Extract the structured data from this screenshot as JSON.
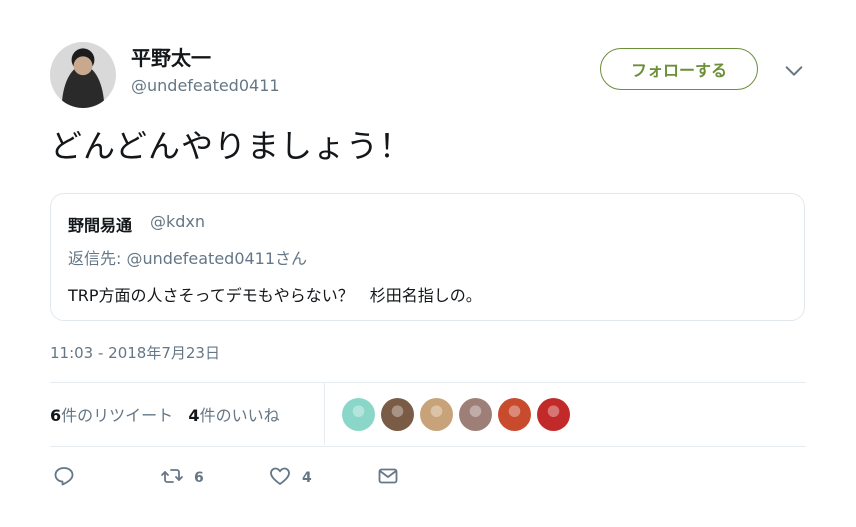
{
  "author": {
    "display_name": "平野太一",
    "handle": "@undefeated0411"
  },
  "follow_button_label": "フォローする",
  "tweet_text": "どんどんやりましょう！",
  "quoted_tweet": {
    "author_name": "野間易通",
    "author_handle": "@kdxn",
    "reply_to": "返信先: @undefeated0411さん",
    "text": "TRP方面の人さそってデモもやらない？　杉田名指しの。"
  },
  "timestamp": "11:03 - 2018年7月23日",
  "stats": {
    "retweet_count": "6",
    "retweet_label": "件のリツイート",
    "like_count": "4",
    "like_label": "件のいいね"
  },
  "liker_avatars": [
    {
      "name": "liker-1",
      "color": "#8ad7c9"
    },
    {
      "name": "liker-2",
      "color": "#7a5b45"
    },
    {
      "name": "liker-3",
      "color": "#c8a37a"
    },
    {
      "name": "liker-4",
      "color": "#9d7f78"
    },
    {
      "name": "liker-5",
      "color": "#c84b2e"
    },
    {
      "name": "liker-6",
      "color": "#c22a2a"
    }
  ],
  "actions": {
    "reply_count": "",
    "retweet_count": "6",
    "like_count": "4"
  },
  "colors": {
    "follow_accent": "#6c8f3a",
    "secondary_text": "#657786"
  }
}
